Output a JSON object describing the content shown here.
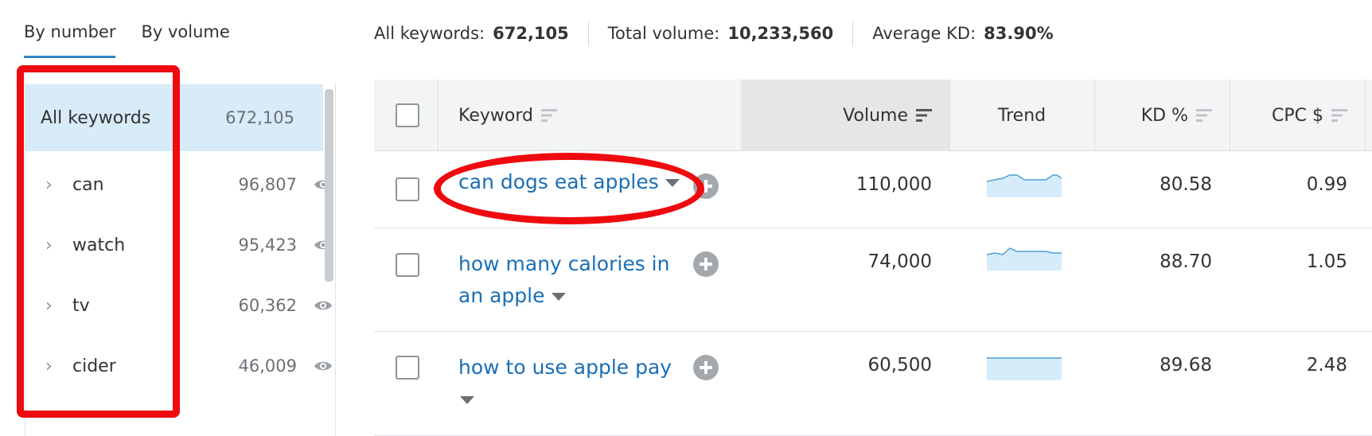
{
  "tabs": [
    {
      "label": "By number",
      "active": true
    },
    {
      "label": "By volume",
      "active": false
    }
  ],
  "groups": [
    {
      "name": "All keywords",
      "count": "672,105"
    },
    {
      "name": "can",
      "count": "96,807"
    },
    {
      "name": "watch",
      "count": "95,423"
    },
    {
      "name": "tv",
      "count": "60,362"
    },
    {
      "name": "cider",
      "count": "46,009"
    }
  ],
  "summary": {
    "all_label": "All keywords:",
    "all_value": "672,105",
    "volume_label": "Total volume:",
    "volume_value": "10,233,560",
    "kd_label": "Average KD:",
    "kd_value": "83.90%"
  },
  "table": {
    "headers": {
      "keyword": "Keyword",
      "volume": "Volume",
      "trend": "Trend",
      "kd": "KD %",
      "cpc": "CPC $"
    },
    "rows": [
      {
        "keyword": "can dogs eat apples",
        "volume": "110,000",
        "kd": "80.58",
        "cpc": "0.99"
      },
      {
        "keyword": "how many calories in an apple",
        "kw_line1": "how many calories in",
        "kw_line2": "an apple",
        "volume": "74,000",
        "kd": "88.70",
        "cpc": "1.05"
      },
      {
        "keyword": "how to use apple pay",
        "volume": "60,500",
        "kd": "89.68",
        "cpc": "2.48"
      }
    ]
  },
  "colors": {
    "link": "#1a6fb6",
    "accent": "#2d86c8",
    "highlight": "#ee0a0f",
    "selected_row": "#d7ebf8",
    "trend_fill": "#d6ecfb",
    "trend_line": "#4a9fd8"
  },
  "icons": [
    "chevron-right-icon",
    "eye-icon",
    "sort-icon",
    "plus-icon",
    "caret-down-icon"
  ]
}
